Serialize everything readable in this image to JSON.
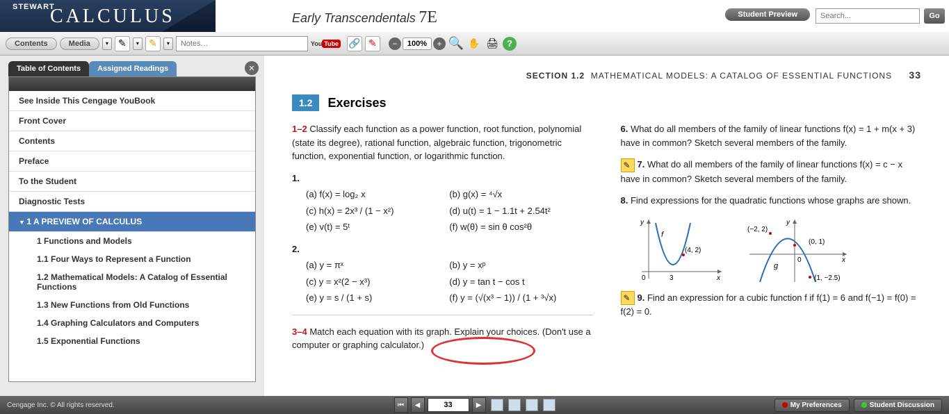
{
  "header": {
    "brand_top": "STEWART",
    "brand_main": "CALCULUS",
    "subtitle": "Early Transcendentals",
    "edition": "7E",
    "student_preview": "Student Preview",
    "search_placeholder": "Search...",
    "go": "Go"
  },
  "toolbar": {
    "contents": "Contents",
    "media": "Media",
    "notes_placeholder": "Notes…",
    "youtube_you": "You",
    "youtube_tube": "Tube",
    "zoom": "100%"
  },
  "sidebar": {
    "tab_toc": "Table of Contents",
    "tab_assigned": "Assigned Readings",
    "items": [
      "See Inside This Cengage YouBook",
      "Front Cover",
      "Contents",
      "Preface",
      "To the Student",
      "Diagnostic Tests"
    ],
    "active": "1   A PREVIEW OF CALCULUS",
    "subs": [
      "1 Functions and Models",
      "1.1 Four Ways to Represent a Function",
      "1.2 Mathematical Models: A Catalog of Essential Functions",
      "1.3 New Functions from Old Functions",
      "1.4 Graphing Calculators and Computers",
      "1.5 Exponential Functions"
    ]
  },
  "page": {
    "section_label": "SECTION 1.2",
    "section_title": "MATHEMATICAL MODELS: A CATALOG OF ESSENTIAL FUNCTIONS",
    "page_num": "33",
    "ex_num": "1.2",
    "ex_word": "Exercises",
    "left": {
      "range12": "1–2",
      "intro12": " Classify each function as a power function, root function, polynomial (state its degree), rational function, algebraic function, trigonometric function, exponential function, or logarithmic function.",
      "p1": "1.",
      "p1a": "(a) f(x) = log₂ x",
      "p1b": "(b) g(x) = ⁴√x",
      "p1c": "(c) h(x) = 2x³ / (1 − x²)",
      "p1d": "(d) u(t) = 1 − 1.1t + 2.54t²",
      "p1e": "(e) v(t) = 5ᵗ",
      "p1f": "(f) w(θ) = sin θ cos²θ",
      "p2": "2.",
      "p2a": "(a) y = πˣ",
      "p2b": "(b) y = xᵖ",
      "p2c": "(c) y = x²(2 − x³)",
      "p2d": "(d) y = tan t − cos t",
      "p2e": "(e) y = s / (1 + s)",
      "p2f": "(f) y = (√(x³ − 1)) / (1 + ³√x)",
      "range34": "3–4",
      "intro34": " Match each equation with its graph. Explain your choices. (Don't use a computer or graphing calculator.)"
    },
    "right": {
      "p6n": "6.",
      "p6": " What do all members of the family of linear functions f(x) = 1 + m(x + 3) have in common? Sketch several members of the family.",
      "p7n": "7.",
      "p7": " What do all members of the family of linear functions f(x) = c − x have in common? Sketch several members of the family.",
      "p8n": "8.",
      "p8": " Find expressions for the quadratic functions whose graphs are shown.",
      "g1_f": "f",
      "g1_pt": "(4, 2)",
      "g1_o": "0",
      "g1_3": "3",
      "g1_x": "x",
      "g1_y": "y",
      "g2_a": "(−2, 2)",
      "g2_b": "(0, 1)",
      "g2_c": "(1, −2.5)",
      "g2_g": "g",
      "g2_o": "0",
      "g2_x": "x",
      "g2_y": "y",
      "p9n": "9.",
      "p9": " Find an expression for a cubic function f if f(1) = 6 and f(−1) = f(0) = f(2) = 0."
    }
  },
  "footer": {
    "copyright": "Cengage Inc.  © All rights reserved.",
    "page_input": "33",
    "prefs": "My Preferences",
    "discussion": "Student Discussion"
  }
}
